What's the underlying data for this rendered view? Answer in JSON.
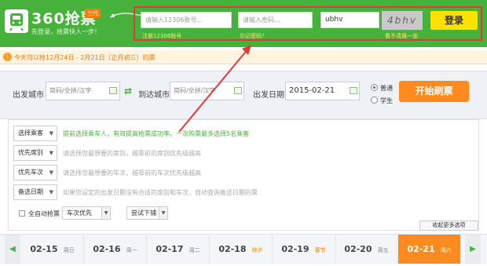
{
  "header": {
    "logo_text": "360抢票",
    "logo_badge": "三代",
    "slogan": "先登录，抢票快人一步！",
    "username_placeholder": "请输入12306账号...",
    "password_placeholder": "请输入密码...",
    "captcha_value": "ubhv",
    "captcha_image_text": "4bhv",
    "login_label": "登录",
    "register_link": "注册12306账号",
    "forgot_link": "忘记密码?",
    "captcha_refresh_link": "看不清换一张",
    "bg_color": "#46b23b"
  },
  "notice": {
    "icon": "!",
    "text": "今天可以抢12月24日 - 2月21日（正月初三）的票"
  },
  "search": {
    "from_label": "出发城市",
    "from_placeholder": "简码/全拼/汉字",
    "swap_icon": "⇄",
    "to_label": "到达城市",
    "to_placeholder": "简码/全拼/汉字",
    "date_label": "出发日期",
    "date_value": "2015-02-21",
    "ticket_normal": "普通",
    "ticket_student": "学生",
    "start_label": "开始刷票",
    "accent_color": "#ff8a1f"
  },
  "options": {
    "passenger_label": "选择乘客",
    "passenger_hint": "提前选择乘车人，有效提高抢票成功率。一次购票最多选择5名乘客",
    "seat_label": "优先席别",
    "seat_hint": "请选择您最想要的席别，越靠前的席别优先级越高",
    "train_label": "优先车次",
    "train_hint": "请选择您最想要的车次，越靠前的车次优先级越高",
    "date_label": "备选日期",
    "date_hint": "如果您设定的出发日期没有合适的席别和车次，自动查询备选日期的票",
    "auto_label": "全自动抢票",
    "train_priority_label": "车次优先",
    "try_lower_label": "尝试下铺",
    "collapse_label": "收起更多选项"
  },
  "date_bar": {
    "prev_icon": "◀",
    "next_icon": "▶",
    "days": [
      {
        "date": "02-15",
        "week": "周日"
      },
      {
        "date": "02-16",
        "week": "周一"
      },
      {
        "date": "02-17",
        "week": "周二"
      },
      {
        "date": "02-18",
        "week": "除夕"
      },
      {
        "date": "02-19",
        "week": "春节"
      },
      {
        "date": "02-20",
        "week": "周五"
      },
      {
        "date": "02-21",
        "week": "周六"
      }
    ],
    "active_index": 6
  }
}
